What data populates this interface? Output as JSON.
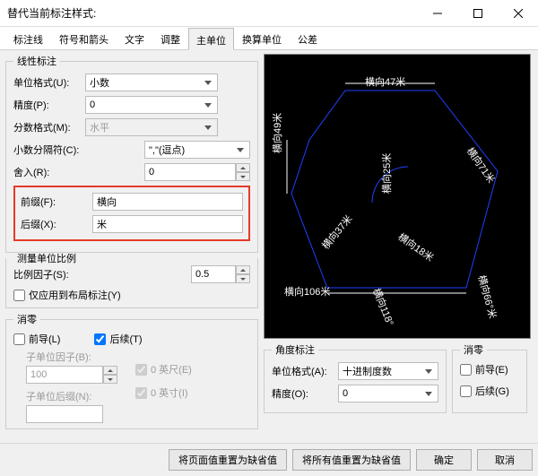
{
  "title": "替代当前标注样式:",
  "tabs": [
    "标注线",
    "符号和箭头",
    "文字",
    "调整",
    "主单位",
    "换算单位",
    "公差"
  ],
  "activeTab": 4,
  "linear": {
    "legend": "线性标注",
    "unitFormat_label": "单位格式(U):",
    "unitFormat_value": "小数",
    "precision_label": "精度(P):",
    "precision_value": "0",
    "fraction_label": "分数格式(M):",
    "fraction_value": "水平",
    "decimalSep_label": "小数分隔符(C):",
    "decimalSep_value": "\",\"(逗点)",
    "round_label": "舍入(R):",
    "round_value": "0",
    "prefix_label": "前缀(F):",
    "prefix_value": "横向",
    "suffix_label": "后缀(X):",
    "suffix_value": "米"
  },
  "scale": {
    "legend": "测量单位比例",
    "factor_label": "比例因子(S):",
    "factor_value": "0.5",
    "layoutOnly_label": "仅应用到布局标注(Y)"
  },
  "zero": {
    "legend": "消零",
    "leading_label": "前导(L)",
    "trailing_label": "后续(T)",
    "subFactor_label": "子单位因子(B):",
    "subFactor_value": "100",
    "subSuffix_label": "子单位后缀(N):",
    "subSuffix_value": "",
    "ft_label": "0 英尺(E)",
    "in_label": "0 英寸(I)"
  },
  "angle": {
    "legend": "角度标注",
    "unitFormat_label": "单位格式(A):",
    "unitFormat_value": "十进制度数",
    "precision_label": "精度(O):",
    "precision_value": "0"
  },
  "angleZero": {
    "legend": "消零",
    "leading_label": "前导(E)",
    "trailing_label": "后续(G)"
  },
  "preview": {
    "labels": [
      "横向47米",
      "横向49米",
      "横向25米",
      "横向71米",
      "横向37米",
      "横向18米",
      "横向106米",
      "横向118°",
      "横向66°米"
    ]
  },
  "footer": {
    "btn1": "将页面值重置为缺省值",
    "btn2": "将所有值重置为缺省值",
    "btn3": "确定",
    "btn4": "取消"
  }
}
